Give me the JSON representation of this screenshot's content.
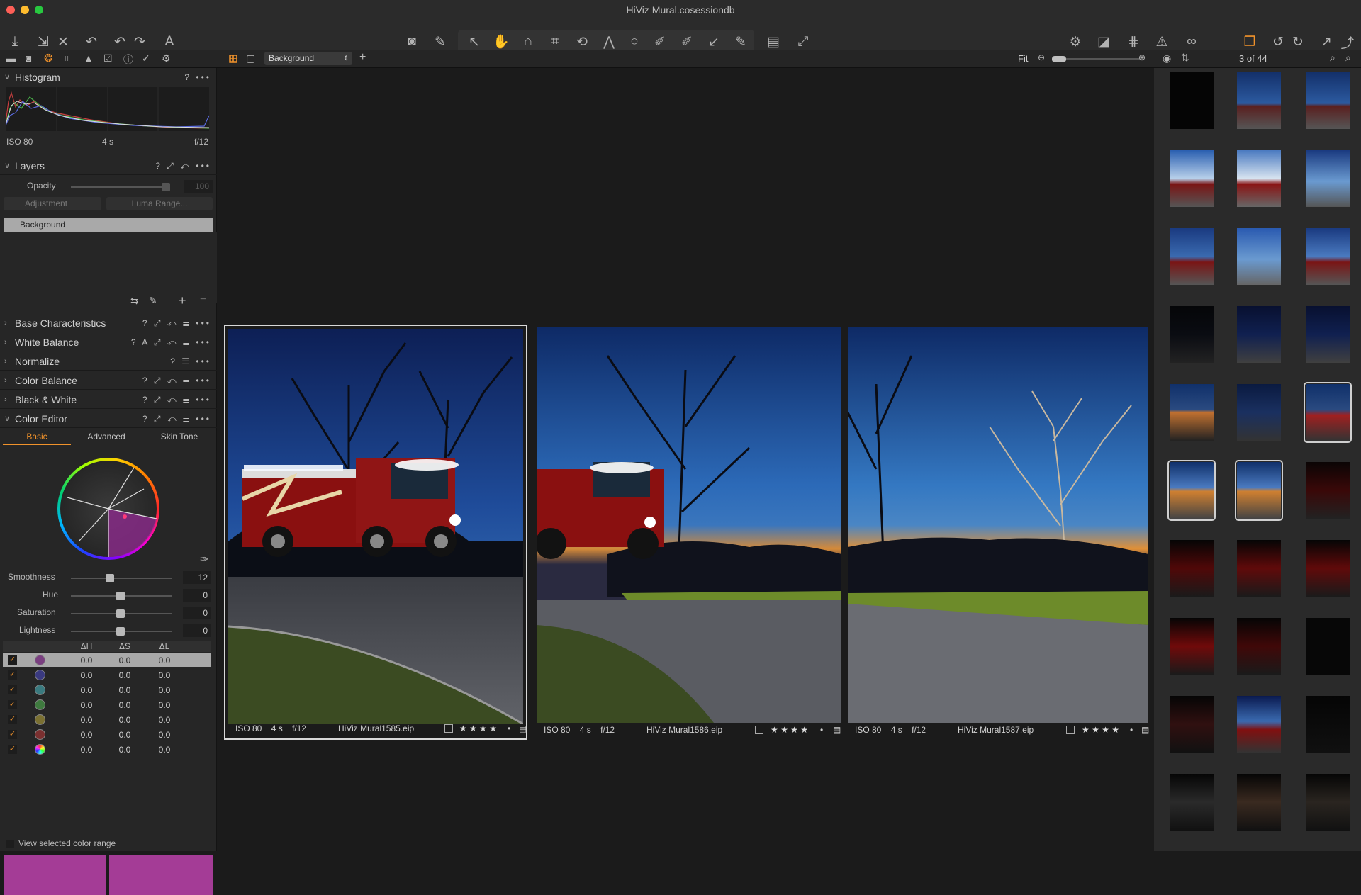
{
  "window": {
    "title": "HiViz Mural.cosessiondb"
  },
  "toolbar": {
    "icons": [
      "import-icon",
      "export-icon",
      "close-icon",
      "undo-back-icon",
      "undo-icon",
      "redo-icon",
      "text-icon"
    ]
  },
  "subbar": {
    "layer_select": "Background",
    "fit_label": "Fit",
    "counter": "3 of 44"
  },
  "histogram": {
    "title": "Histogram",
    "help": "?",
    "iso": "ISO 80",
    "shutter": "4 s",
    "aperture": "f/12"
  },
  "layers": {
    "title": "Layers",
    "help": "?",
    "opacity_label": "Opacity",
    "opacity_value": "100",
    "adjustment_label": "Adjustment",
    "luma_label": "Luma Range...",
    "layer_name": "Background"
  },
  "tools": {
    "base": {
      "title": "Base Characteristics",
      "help": "?"
    },
    "wb": {
      "title": "White Balance",
      "help": "?",
      "auto": "A"
    },
    "normalize": {
      "title": "Normalize",
      "help": "?"
    },
    "color_balance": {
      "title": "Color Balance",
      "help": "?"
    },
    "bw": {
      "title": "Black & White",
      "help": "?"
    },
    "color_editor": {
      "title": "Color Editor",
      "help": "?"
    }
  },
  "color_editor": {
    "tabs": [
      "Basic",
      "Advanced",
      "Skin Tone"
    ],
    "active_tab": 0,
    "sliders": [
      {
        "label": "Smoothness",
        "value": "12",
        "level": 0.4
      },
      {
        "label": "Hue",
        "value": "0",
        "level": 0.5
      },
      {
        "label": "Saturation",
        "value": "0",
        "level": 0.5
      },
      {
        "label": "Lightness",
        "value": "0",
        "level": 0.5
      }
    ],
    "col_headers": [
      "ΔH",
      "ΔS",
      "ΔL"
    ],
    "rows": [
      {
        "color": "#7a3f80",
        "dh": "0.0",
        "ds": "0.0",
        "dl": "0.0",
        "selected": true
      },
      {
        "color": "#3a3a80",
        "dh": "0.0",
        "ds": "0.0",
        "dl": "0.0",
        "selected": false
      },
      {
        "color": "#3a7a7f",
        "dh": "0.0",
        "ds": "0.0",
        "dl": "0.0",
        "selected": false
      },
      {
        "color": "#3f7a3f",
        "dh": "0.0",
        "ds": "0.0",
        "dl": "0.0",
        "selected": false
      },
      {
        "color": "#7a7032",
        "dh": "0.0",
        "ds": "0.0",
        "dl": "0.0",
        "selected": false
      },
      {
        "color": "#7a3030",
        "dh": "0.0",
        "ds": "0.0",
        "dl": "0.0",
        "selected": false
      },
      {
        "color": "rainbow",
        "dh": "0.0",
        "ds": "0.0",
        "dl": "0.0",
        "selected": false
      }
    ],
    "view_range_label": "View selected color range",
    "swatch_color": "#a43c96"
  },
  "viewer": {
    "images": [
      {
        "iso": "ISO 80",
        "shutter": "4 s",
        "aperture": "f/12",
        "filename": "HiViz Mural1585.eip",
        "stars": "★ ★ ★ ★",
        "selected": true
      },
      {
        "iso": "ISO 80",
        "shutter": "4 s",
        "aperture": "f/12",
        "filename": "HiViz Mural1586.eip",
        "stars": "★ ★ ★ ★",
        "selected": false
      },
      {
        "iso": "ISO 80",
        "shutter": "4 s",
        "aperture": "f/12",
        "filename": "HiViz Mural1587.eip",
        "stars": "★ ★ ★ ★",
        "selected": false
      }
    ]
  },
  "colors": {
    "accent": "#f0922b",
    "panel": "#262626",
    "swatch": "#a43c96"
  }
}
